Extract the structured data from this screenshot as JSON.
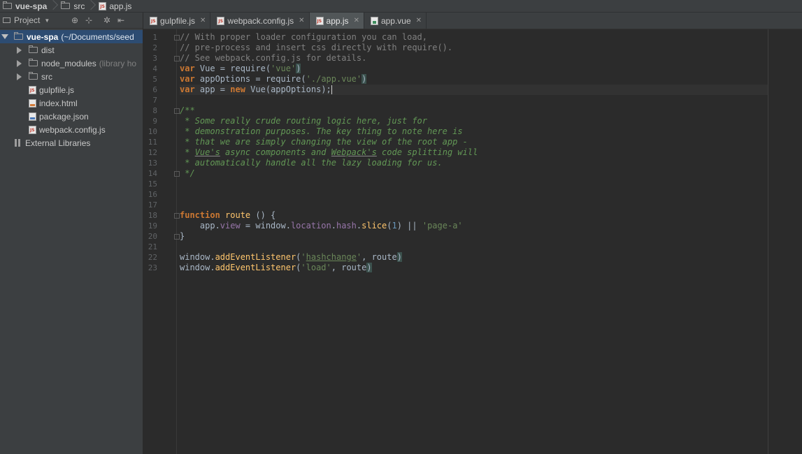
{
  "breadcrumbs": [
    "vue-spa",
    "src",
    "app.js"
  ],
  "project_panel": {
    "title": "Project",
    "tree": [
      {
        "label": "vue-spa",
        "note": "(~/Documents/seed",
        "level": 0,
        "kind": "root",
        "expanded": true
      },
      {
        "label": "dist",
        "note": "",
        "level": 1,
        "kind": "folder",
        "expanded": false
      },
      {
        "label": "node_modules",
        "note": "(library ho",
        "level": 1,
        "kind": "folder",
        "expanded": false
      },
      {
        "label": "src",
        "note": "",
        "level": 1,
        "kind": "folder",
        "expanded": false
      },
      {
        "label": "gulpfile.js",
        "note": "",
        "level": 2,
        "kind": "js"
      },
      {
        "label": "index.html",
        "note": "",
        "level": 2,
        "kind": "html"
      },
      {
        "label": "package.json",
        "note": "",
        "level": 2,
        "kind": "json"
      },
      {
        "label": "webpack.config.js",
        "note": "",
        "level": 2,
        "kind": "js"
      },
      {
        "label": "External Libraries",
        "note": "",
        "level": 0,
        "kind": "libs"
      }
    ]
  },
  "tabs": [
    {
      "label": "gulpfile.js",
      "kind": "js",
      "active": false
    },
    {
      "label": "webpack.config.js",
      "kind": "js",
      "active": false
    },
    {
      "label": "app.js",
      "kind": "js",
      "active": true
    },
    {
      "label": "app.vue",
      "kind": "vue",
      "active": false
    }
  ],
  "editor": {
    "line_count": 23,
    "lines": [
      "// With proper loader configuration you can load,",
      "// pre-process and insert css directly with require().",
      "// See webpack.config.js for details.",
      "var Vue = require('vue')",
      "var appOptions = require('./app.vue')",
      "var app = new Vue(appOptions);",
      "",
      "/**",
      " * Some really crude routing logic here, just for",
      " * demonstration purposes. The key thing to note here is",
      " * that we are simply changing the view of the root app -",
      " * Vue's async components and Webpack's code splitting will",
      " * automatically handle all the lazy loading for us.",
      " */",
      "",
      "",
      "",
      "function route () {",
      "    app.view = window.location.hash.slice(1) || 'page-a'",
      "}",
      "",
      "window.addEventListener('hashchange', route)",
      "window.addEventListener('load', route)"
    ]
  }
}
